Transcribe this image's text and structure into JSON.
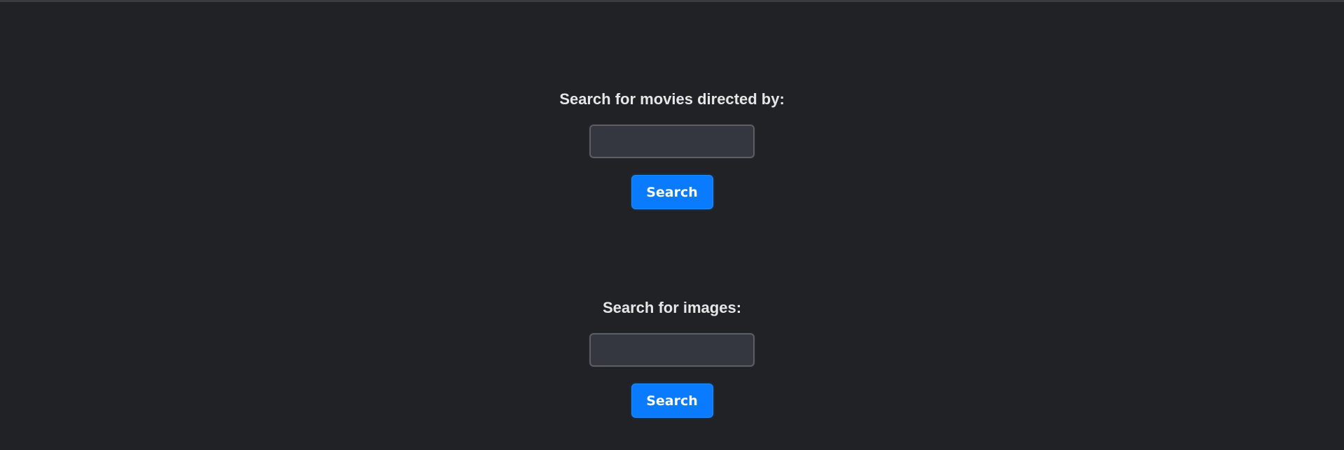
{
  "movie_search": {
    "label": "Search for movies directed by:",
    "input_value": "",
    "input_placeholder": "",
    "button_label": "Search"
  },
  "image_search": {
    "label": "Search for images:",
    "input_value": "",
    "input_placeholder": "",
    "button_label": "Search"
  },
  "colors": {
    "background": "#212226",
    "button": "#0a7bff",
    "input_bg": "#343640",
    "label_text": "#e6e6e6"
  }
}
